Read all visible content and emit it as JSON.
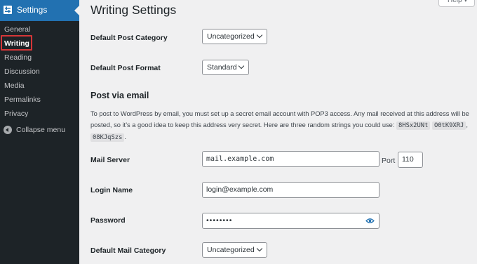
{
  "sidebar": {
    "title": "Settings",
    "items": [
      {
        "label": "General"
      },
      {
        "label": "Writing"
      },
      {
        "label": "Reading"
      },
      {
        "label": "Discussion"
      },
      {
        "label": "Media"
      },
      {
        "label": "Permalinks"
      },
      {
        "label": "Privacy"
      }
    ],
    "current": "Writing",
    "collapse_label": "Collapse menu"
  },
  "header": {
    "title": "Writing Settings",
    "help_label": "Help ▾"
  },
  "form": {
    "default_post_category": {
      "label": "Default Post Category",
      "value": "Uncategorized"
    },
    "default_post_format": {
      "label": "Default Post Format",
      "value": "Standard"
    },
    "post_via_email": {
      "title": "Post via email",
      "description": "To post to WordPress by email, you must set up a secret email account with POP3 access. Any mail received at this address will be posted, so it’s a good idea to keep this address very secret. Here are three random strings you could use:",
      "random_strings": [
        "8HSx2UNt",
        "O0tK9XRJ",
        "08KJqSzs"
      ]
    },
    "mail_server": {
      "label": "Mail Server",
      "value": "mail.example.com",
      "port_label": "Port",
      "port_value": "110"
    },
    "login_name": {
      "label": "Login Name",
      "value": "login@example.com"
    },
    "password": {
      "label": "Password",
      "value": "••••••••"
    },
    "default_mail_category": {
      "label": "Default Mail Category",
      "value": "Uncategorized"
    }
  },
  "colors": {
    "sidebar_bg": "#1d2327",
    "accent": "#2271b1",
    "highlight_box": "#d63638",
    "page_bg": "#f0f0f1"
  },
  "icons": [
    "wordpress-settings-icon",
    "collapse-menu-icon",
    "chevron-down-icon",
    "show-password-icon"
  ]
}
